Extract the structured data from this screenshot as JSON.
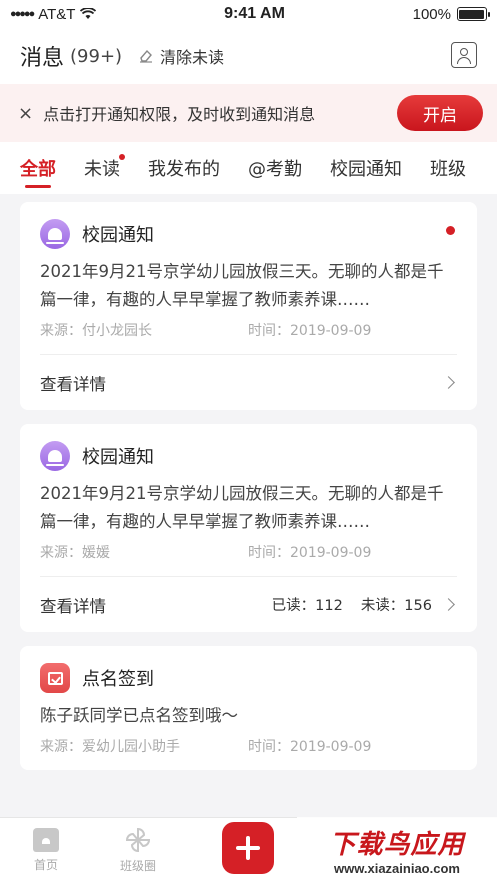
{
  "status_bar": {
    "carrier": "AT&T",
    "signal_dots": "●●●●●",
    "time": "9:41 AM",
    "battery": "100%"
  },
  "header": {
    "title": "消息",
    "count": "(99+)",
    "clear_label": "清除未读"
  },
  "notice": {
    "close_glyph": "×",
    "text": "点击打开通知权限，及时收到通知消息",
    "open_label": "开启"
  },
  "tabs": [
    {
      "label": "全部",
      "active": true
    },
    {
      "label": "未读",
      "dot": true
    },
    {
      "label": "我发布的"
    },
    {
      "label": "@考勤"
    },
    {
      "label": "校园通知"
    },
    {
      "label": "班级"
    }
  ],
  "cards": [
    {
      "icon": "bell-icon",
      "title": "校园通知",
      "unread": true,
      "body": "2021年9月21号京学幼儿园放假三天。无聊的人都是千篇一律，有趣的人早早掌握了教师素养课……",
      "source": "来源：付小龙园长",
      "time": "时间：2019-09-09",
      "foot_label": "查看详情"
    },
    {
      "icon": "bell-icon",
      "title": "校园通知",
      "unread": false,
      "body": "2021年9月21号京学幼儿园放假三天。无聊的人都是千篇一律，有趣的人早早掌握了教师素养课……",
      "source": "来源：媛媛",
      "time": "时间：2019-09-09",
      "foot_label": "查看详情",
      "read_stat": "已读：112",
      "unread_stat": "未读：156"
    },
    {
      "icon": "calendar-check-icon",
      "title": "点名签到",
      "body": "陈子跃同学已点名签到哦～",
      "source": "来源：爱幼儿园小助手",
      "time": "时间：2019-09-09"
    }
  ],
  "tabbar": {
    "home_label": "首页",
    "class_label": "班级圈"
  },
  "watermark": {
    "title": "下载鸟应用",
    "url": "www.xiazainiao.com"
  },
  "colors": {
    "accent": "#d52026",
    "purple": "#9a68e3",
    "notice_bg": "#fcf1f1"
  }
}
